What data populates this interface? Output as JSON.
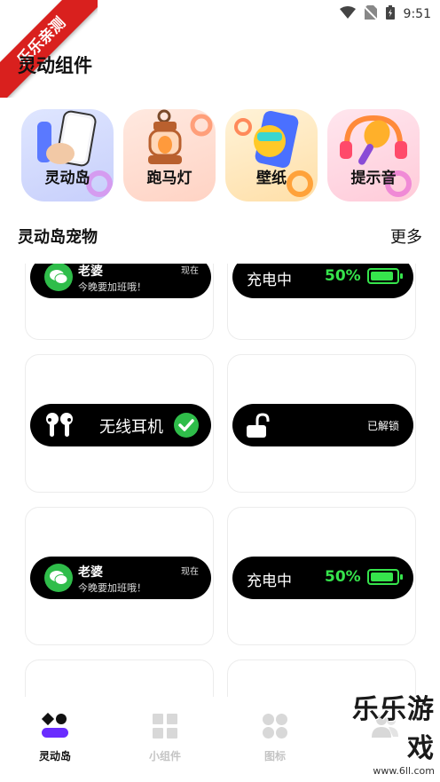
{
  "status_bar": {
    "time": "9:51"
  },
  "ribbon": {
    "text": "乐乐亲测"
  },
  "app": {
    "title": "灵动组件"
  },
  "categories": [
    {
      "label": "灵动岛"
    },
    {
      "label": "跑马灯"
    },
    {
      "label": "壁纸"
    },
    {
      "label": "提示音"
    }
  ],
  "section": {
    "title": "灵动岛宠物",
    "more": "更多"
  },
  "widgets": {
    "wechat": {
      "name": "老婆",
      "message": "今晚要加班哦！",
      "time": "现在"
    },
    "charging": {
      "label": "充电中",
      "percent": "50%",
      "level": 0.5
    },
    "earphones": {
      "label": "无线耳机"
    },
    "unlocked": {
      "label": "已解锁"
    }
  },
  "nav": [
    {
      "label": "灵动岛",
      "active": true
    },
    {
      "label": "小组件",
      "active": false
    },
    {
      "label": "图标",
      "active": false
    },
    {
      "label": "",
      "active": false
    }
  ],
  "watermark": {
    "brand": "乐乐游戏",
    "url": "www.6ll.com"
  },
  "colors": {
    "accent_green": "#36e44c",
    "wechat_green": "#2fbd4a",
    "ribbon_red": "#d9201e"
  }
}
